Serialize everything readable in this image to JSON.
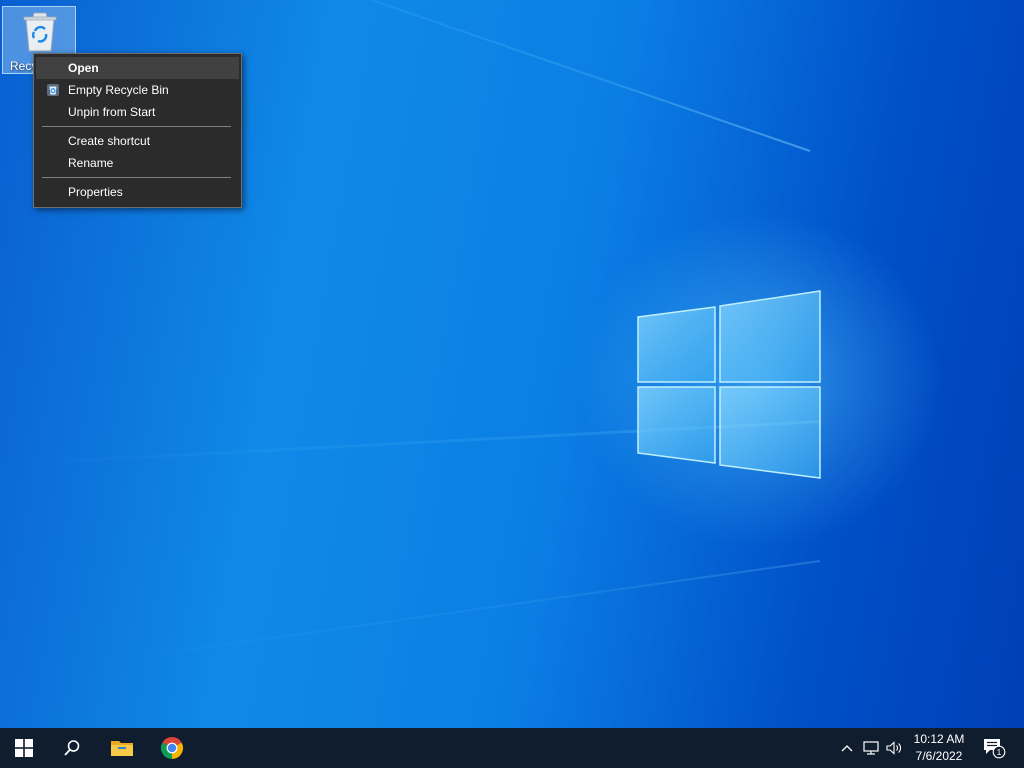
{
  "desktop": {
    "icons": [
      {
        "label": "Recycle Bin",
        "icon": "recycle-bin-icon",
        "selected": true
      }
    ]
  },
  "context_menu": {
    "items": [
      {
        "label": "Open",
        "bold": true,
        "highlighted": true
      },
      {
        "label": "Empty Recycle Bin",
        "icon": "recycle-bin-icon"
      },
      {
        "label": "Unpin from Start"
      },
      {
        "label": "Create shortcut"
      },
      {
        "label": "Rename"
      },
      {
        "label": "Properties"
      }
    ]
  },
  "taskbar": {
    "start_icon": "windows-start-icon",
    "search_icon": "search-icon",
    "pinned": [
      {
        "name": "File Explorer",
        "icon": "file-explorer-icon"
      },
      {
        "name": "Google Chrome",
        "icon": "chrome-icon"
      }
    ],
    "tray": {
      "chevron_icon": "chevron-up-icon",
      "network_icon": "network-icon",
      "volume_icon": "volume-icon",
      "time": "10:12 AM",
      "date": "7/6/2022",
      "notification_icon": "action-center-icon",
      "notification_count": "1"
    }
  },
  "colors": {
    "taskbar_bg": "#101d2e",
    "menu_bg": "#2b2b2b",
    "desktop_accent": "#0f8ae8"
  }
}
